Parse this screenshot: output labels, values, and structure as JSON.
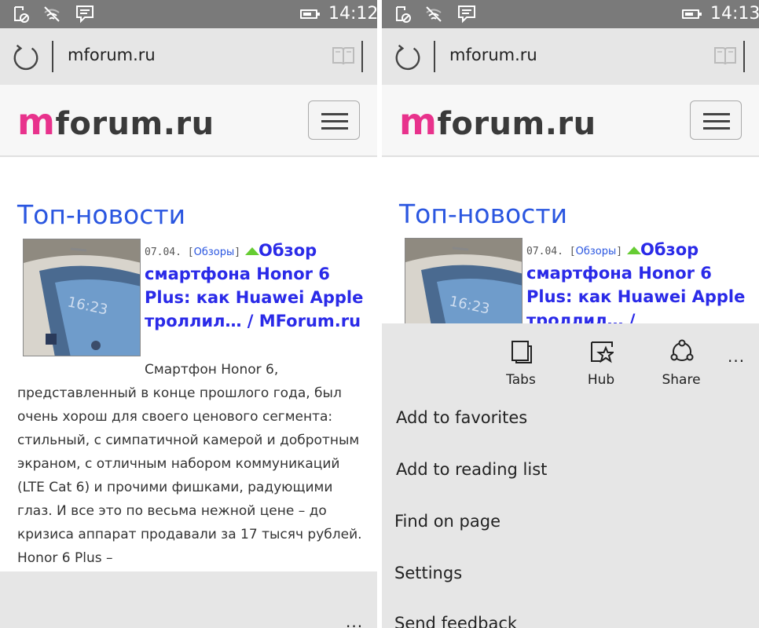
{
  "left": {
    "status": {
      "time": "14:12",
      "battery_level": 0.55
    },
    "address": {
      "url": "mforum.ru"
    },
    "site": {
      "logo_m": "m",
      "logo_rest": "forum.ru"
    },
    "section_title": "Топ-новости",
    "article": {
      "date": "07.04.",
      "category_open": "[",
      "category": "Обзоры",
      "category_close": "]",
      "headline": "Обзор смартфона Honor 6 Plus: как Huawei Apple троллил… / MForum.ru",
      "body": "Смартфон Honor 6, представленный в конце прошлого года, был очень хорош для своего ценового сегмента: стильный, с симпатичной камерой и добротным экраном, с отличным набором коммуникаций (LTE Cat 6) и прочими фишками, радующими глаз. И все это по весьма нежной цене – до кризиса аппарат продавали за 17 тысяч рублей. Honor 6 Plus –"
    },
    "bottom_more": "..."
  },
  "right": {
    "status": {
      "time": "14:13",
      "battery_level": 0.55
    },
    "address": {
      "url": "mforum.ru"
    },
    "site": {
      "logo_m": "m",
      "logo_rest": "forum.ru"
    },
    "section_title": "Топ-новости",
    "article": {
      "date": "07.04.",
      "category_open": "[",
      "category": "Обзоры",
      "category_close": "]",
      "headline": "Обзор смартфона Honor 6 Plus: как Huawei Apple троллил… /"
    },
    "menu": {
      "buttons": [
        {
          "label": "Tabs",
          "icon": "tabs-icon"
        },
        {
          "label": "Hub",
          "icon": "hub-star-icon"
        },
        {
          "label": "Share",
          "icon": "share-icon"
        }
      ],
      "more": "...",
      "items": [
        "Add to favorites",
        "Add to reading list",
        "Find on page",
        "Settings",
        "Send feedback"
      ]
    }
  },
  "colors": {
    "status_bar": "#7a7a7a",
    "chrome": "#e6e6e6",
    "link_blue": "#2a56e0",
    "headline_blue": "#2a2ae8",
    "logo_pink": "#e8328c",
    "new_arrow_green": "#66cc33"
  }
}
